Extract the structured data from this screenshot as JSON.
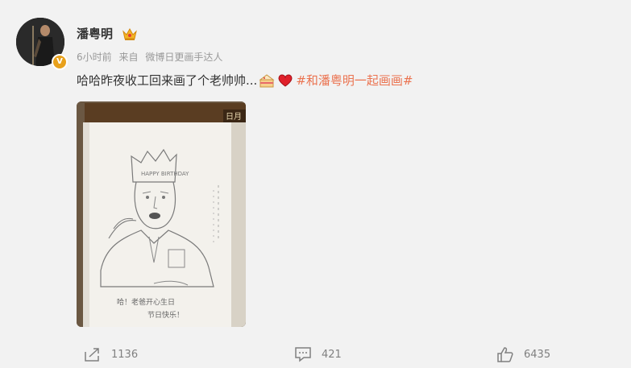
{
  "post": {
    "author": "潘粤明",
    "time": "6小时前",
    "source_prefix": "来自",
    "source_name": "微博日更画手达人",
    "text": "哈哈昨夜收工回来画了个老帅帅...",
    "hashtag": "#和潘粤明一起画画#",
    "image": {
      "notebook_label": "日月",
      "sketch_caption_line1": "哈！老爸开心生日",
      "sketch_caption_line2": "节日快乐！"
    }
  },
  "actions": {
    "repost_count": "1136",
    "comment_count": "421",
    "like_count": "6435"
  },
  "icons": {
    "verified_badge": "verified-v-badge-icon",
    "crown": "crown-icon",
    "cake": "cake-emoji-icon",
    "heart": "heart-emoji-icon",
    "repost": "repost-icon",
    "comment": "comment-icon",
    "like": "thumbs-up-icon"
  },
  "colors": {
    "background": "#f2f2f2",
    "hashtag": "#eb7350",
    "verified": "#e8a11c",
    "heart": "#e0202a"
  }
}
